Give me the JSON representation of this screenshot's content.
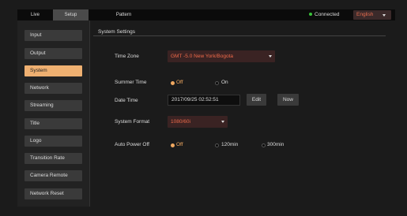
{
  "topbar": {
    "tabs": [
      {
        "label": "Live"
      },
      {
        "label": "Setup"
      },
      {
        "label": "Pattern"
      }
    ],
    "status": "Connected",
    "status_color": "#39c239",
    "language": "English"
  },
  "sidebar": {
    "items": [
      {
        "label": "Input"
      },
      {
        "label": "Output"
      },
      {
        "label": "System"
      },
      {
        "label": "Network"
      },
      {
        "label": "Streaming"
      },
      {
        "label": "Title"
      },
      {
        "label": "Logo"
      },
      {
        "label": "Transition Rate"
      },
      {
        "label": "Camera Remote"
      },
      {
        "label": "Network Reset"
      }
    ],
    "active_color": "#efb071"
  },
  "panel": {
    "title": "System Settings",
    "time_zone": {
      "label": "Time Zone",
      "value": "GMT -5.0 New York/Bogota"
    },
    "summer_time": {
      "label": "Summer Time",
      "options": [
        "Off",
        "On"
      ],
      "selected": "Off"
    },
    "date_time": {
      "label": "Date Time",
      "value": "2017/09/25 02:52:51",
      "edit_label": "Edit",
      "now_label": "Now"
    },
    "system_format": {
      "label": "System Format",
      "value": "1080/60i"
    },
    "auto_power_off": {
      "label": "Auto Power Off",
      "options": [
        "Off",
        "120min",
        "300min"
      ],
      "selected": "Off"
    }
  },
  "accent_color": "#f0a860",
  "select_text_color": "#f06a4a"
}
